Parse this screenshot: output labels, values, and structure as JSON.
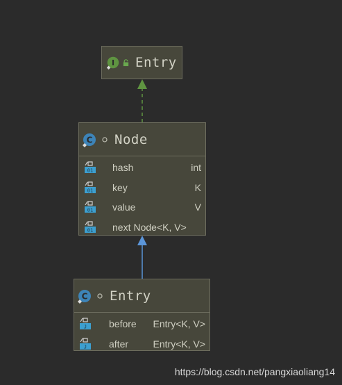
{
  "colors": {
    "background": "#2b2b2b",
    "node_fill": "#47473b",
    "node_border": "#6d6d5e",
    "implements_arrow": "#5f9441",
    "extends_arrow": "#5b95d8",
    "class_icon": "#3d84b8",
    "interface_icon": "#5f9441"
  },
  "diagram": {
    "interface_entry": {
      "kind": "interface",
      "name": "Entry",
      "icon": "interface-icon",
      "badge": "lock-icon"
    },
    "node": {
      "kind": "class",
      "name": "Node",
      "icon": "class-icon",
      "visibility_icon": "package-private-icon",
      "members": [
        {
          "name": "hash",
          "type": "int",
          "icon": "final-field-icon"
        },
        {
          "name": "key",
          "type": "K",
          "icon": "final-field-icon"
        },
        {
          "name": "value",
          "type": "V",
          "icon": "field-icon"
        },
        {
          "name": "next",
          "type": "Node<K, V>",
          "icon": "field-icon"
        }
      ]
    },
    "entry": {
      "kind": "class",
      "name": "Entry",
      "icon": "class-icon",
      "visibility_icon": "package-private-icon",
      "members": [
        {
          "name": "before",
          "type": "Entry<K, V>",
          "icon": "field-icon"
        },
        {
          "name": "after",
          "type": "Entry<K, V>",
          "icon": "field-icon"
        }
      ]
    },
    "relations": [
      {
        "from": "Node",
        "to": "Entry (interface)",
        "kind": "implements"
      },
      {
        "from": "Entry (class)",
        "to": "Node",
        "kind": "extends"
      }
    ]
  },
  "watermark": "https://blog.csdn.net/pangxiaoliang14"
}
